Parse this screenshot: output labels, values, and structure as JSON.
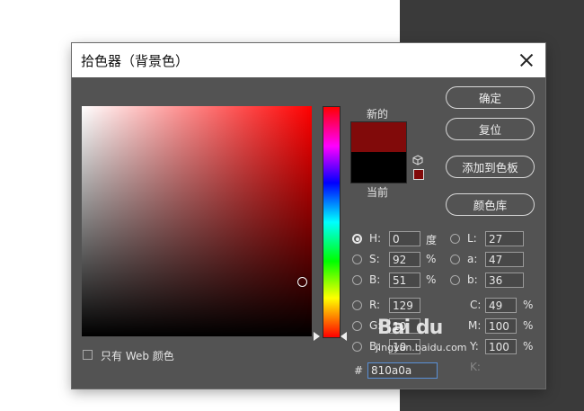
{
  "dialog": {
    "title": "拾色器（背景色）",
    "new_label": "新的",
    "current_label": "当前",
    "new_color": "#810a0a",
    "current_color": "#000000"
  },
  "buttons": {
    "ok": "确定",
    "reset": "复位",
    "add_to_swatches": "添加到色板",
    "color_libraries": "颜色库"
  },
  "hsb": {
    "h_label": "H:",
    "h_value": "0",
    "h_unit": "度",
    "s_label": "S:",
    "s_value": "92",
    "s_unit": "%",
    "b_label": "B:",
    "b_value": "51",
    "b_unit": "%"
  },
  "lab": {
    "l_label": "L:",
    "l_value": "27",
    "a_label": "a:",
    "a_value": "47",
    "b_label": "b:",
    "b_value": "36"
  },
  "rgb": {
    "r_label": "R:",
    "r_value": "129",
    "g_label": "G:",
    "g_value": "10",
    "b_label": "B:",
    "b_value": "10"
  },
  "cmyk": {
    "c_label": "C:",
    "c_value": "49",
    "c_unit": "%",
    "m_label": "M:",
    "m_value": "100",
    "m_unit": "%",
    "y_label": "Y:",
    "y_value": "100",
    "y_unit": "%",
    "k_label": "K:"
  },
  "hex": {
    "label": "#",
    "value": "810a0a"
  },
  "web_only": {
    "label": "只有 Web 颜色"
  },
  "watermark": {
    "logo": "Bai du",
    "url": "jingyan.baidu.com"
  }
}
